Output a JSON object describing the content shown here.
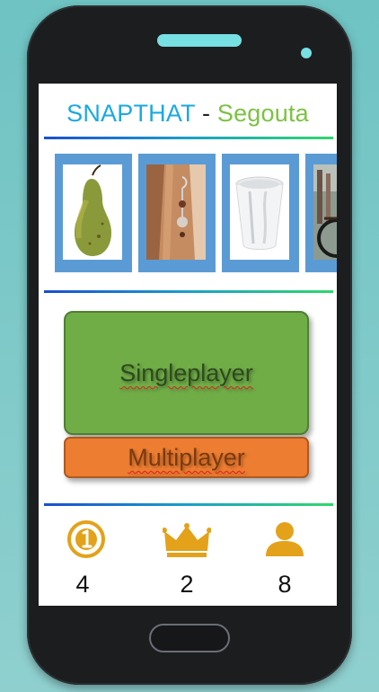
{
  "header": {
    "app_name": "SNAPTHAT",
    "separator": "-",
    "subtitle": "Segouta"
  },
  "gallery": {
    "items": [
      {
        "name": "pear"
      },
      {
        "name": "earring"
      },
      {
        "name": "paper-cup"
      },
      {
        "name": "bicycle"
      }
    ]
  },
  "menu": {
    "single_label": "Singleplayer",
    "multi_label": "Multiplayer"
  },
  "stats": {
    "first_place": "4",
    "crown": "2",
    "players": "8"
  },
  "colors": {
    "title_blue": "#1aa9e0",
    "title_green": "#7cc242",
    "tile_blue": "#5b9bd5",
    "single_green": "#70ad47",
    "multi_orange": "#ed7d31",
    "icon_gold": "#e3a21a"
  }
}
